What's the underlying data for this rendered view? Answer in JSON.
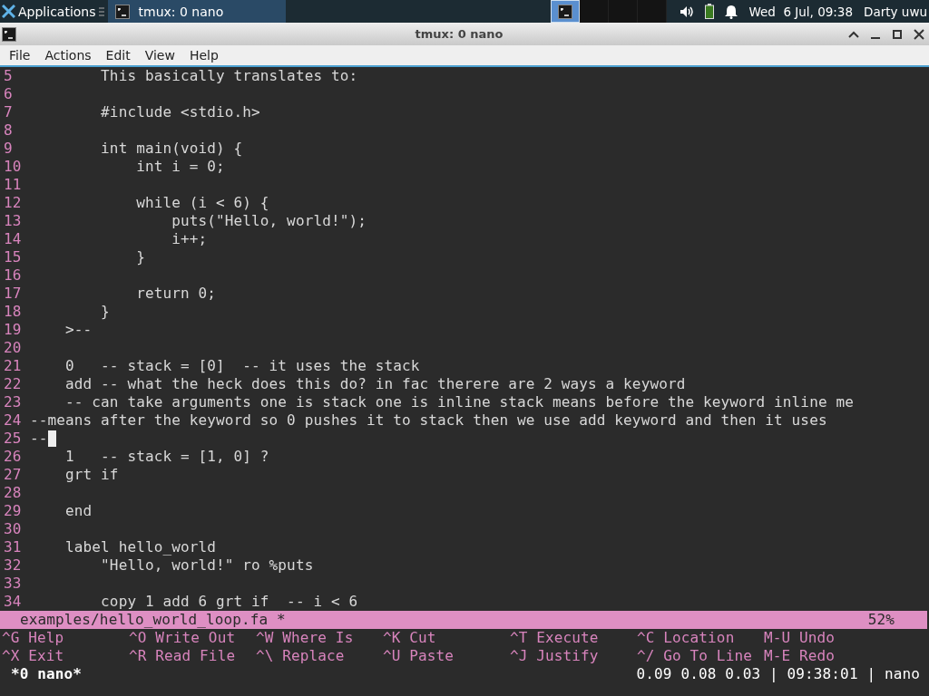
{
  "panel": {
    "apps_label": "Applications",
    "tasks": [
      {
        "label": "tmux: 0 nano",
        "selected": true
      }
    ],
    "workspaces": [
      {
        "selected": true
      },
      {
        "selected": false
      },
      {
        "selected": false
      },
      {
        "selected": false
      }
    ],
    "clock": "Wed  6 Jul, 09:38",
    "user": "Darty uwu"
  },
  "window": {
    "title": "tmux: 0 nano"
  },
  "menu": [
    "File",
    "Actions",
    "Edit",
    "View",
    "Help"
  ],
  "editor": {
    "lines": [
      {
        "number": "5",
        "text": "        This basically translates to:"
      },
      {
        "number": "6"
      },
      {
        "number": "7",
        "text": "        #include <stdio.h>"
      },
      {
        "number": "8"
      },
      {
        "number": "9",
        "text": "        int main(void) {"
      },
      {
        "number": "10",
        "text": "            int i = 0;"
      },
      {
        "number": "11"
      },
      {
        "number": "12",
        "text": "            while (i < 6) {"
      },
      {
        "number": "13",
        "text": "                puts(\"Hello, world!\");"
      },
      {
        "number": "14",
        "text": "                i++;"
      },
      {
        "number": "15",
        "text": "            }"
      },
      {
        "number": "16"
      },
      {
        "number": "17",
        "text": "            return 0;"
      },
      {
        "number": "18",
        "text": "        }"
      },
      {
        "number": "19",
        "text": "    >--"
      },
      {
        "number": "20"
      },
      {
        "number": "21",
        "text": "    0   -- stack = [0]  -- it uses the stack"
      },
      {
        "number": "22",
        "text": "    add -- what the heck does this do? in fac therere are 2 ways a keyword"
      },
      {
        "number": "23",
        "text": "    -- can take arguments one is stack one is inline stack means before the keyword inline me"
      },
      {
        "number": "24",
        "text": "--means after the keyword so 0 pushes it to stack then we use add keyword and then it uses"
      },
      {
        "number": "25",
        "text": "--",
        "cursor": true
      },
      {
        "number": "26",
        "text": "    1   -- stack = [1, 0] ?"
      },
      {
        "number": "27",
        "text": "    grt if"
      },
      {
        "number": "28"
      },
      {
        "number": "29",
        "text": "    end"
      },
      {
        "number": "30"
      },
      {
        "number": "31",
        "text": "    label hello_world"
      },
      {
        "number": "32",
        "text": "        \"Hello, world!\" ro %puts"
      },
      {
        "number": "33"
      },
      {
        "number": "34",
        "text": "        copy 1 add 6 grt if  -- i < 6"
      }
    ],
    "status": {
      "file": "examples/hello_world_loop.fa *",
      "percent": "52%"
    },
    "shortcuts": [
      [
        {
          "key": "^G",
          "label": "Help"
        },
        {
          "key": "^O",
          "label": "Write Out"
        },
        {
          "key": "^W",
          "label": "Where Is"
        },
        {
          "key": "^K",
          "label": "Cut"
        },
        {
          "key": "^T",
          "label": "Execute"
        },
        {
          "key": "^C",
          "label": "Location"
        },
        {
          "key": "M-U",
          "label": "Undo"
        }
      ],
      [
        {
          "key": "^X",
          "label": "Exit"
        },
        {
          "key": "^R",
          "label": "Read File"
        },
        {
          "key": "^\\",
          "label": "Replace"
        },
        {
          "key": "^U",
          "label": "Paste"
        },
        {
          "key": "^J",
          "label": "Justify"
        },
        {
          "key": "^/",
          "label": "Go To Line"
        },
        {
          "key": "M-E",
          "label": "Redo"
        }
      ]
    ]
  },
  "tmux": {
    "session": "*0 nano*",
    "right": "0.09 0.08 0.03 | 09:38:01 | nano"
  }
}
